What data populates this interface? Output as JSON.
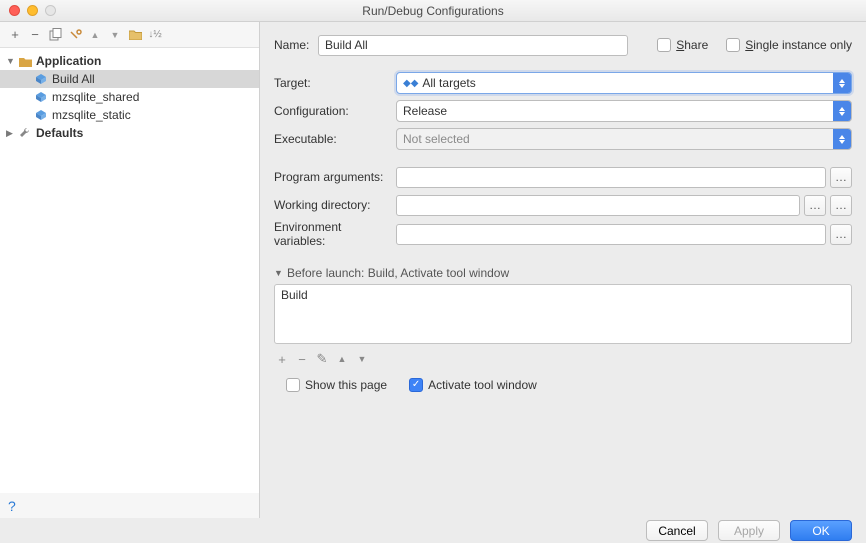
{
  "window": {
    "title": "Run/Debug Configurations"
  },
  "tree": {
    "application": {
      "label": "Application",
      "items": [
        "Build All",
        "mzsqlite_shared",
        "mzsqlite_static"
      ],
      "selected": 0
    },
    "defaults": {
      "label": "Defaults"
    }
  },
  "form": {
    "name_label": "Name:",
    "name_value": "Build All",
    "share_label": "Share",
    "single_instance_label": "Single instance only",
    "target_label": "Target:",
    "target_value": "All targets",
    "configuration_label": "Configuration:",
    "configuration_value": "Release",
    "executable_label": "Executable:",
    "executable_value": "Not selected",
    "program_arguments_label": "Program arguments:",
    "working_directory_label": "Working directory:",
    "env_vars_label": "Environment variables:"
  },
  "before_launch": {
    "title": "Before launch: Build, Activate tool window",
    "items": [
      "Build"
    ],
    "show_this_page_label": "Show this page",
    "activate_label": "Activate tool window",
    "activate_checked": true
  },
  "buttons": {
    "cancel": "Cancel",
    "apply": "Apply",
    "ok": "OK"
  }
}
